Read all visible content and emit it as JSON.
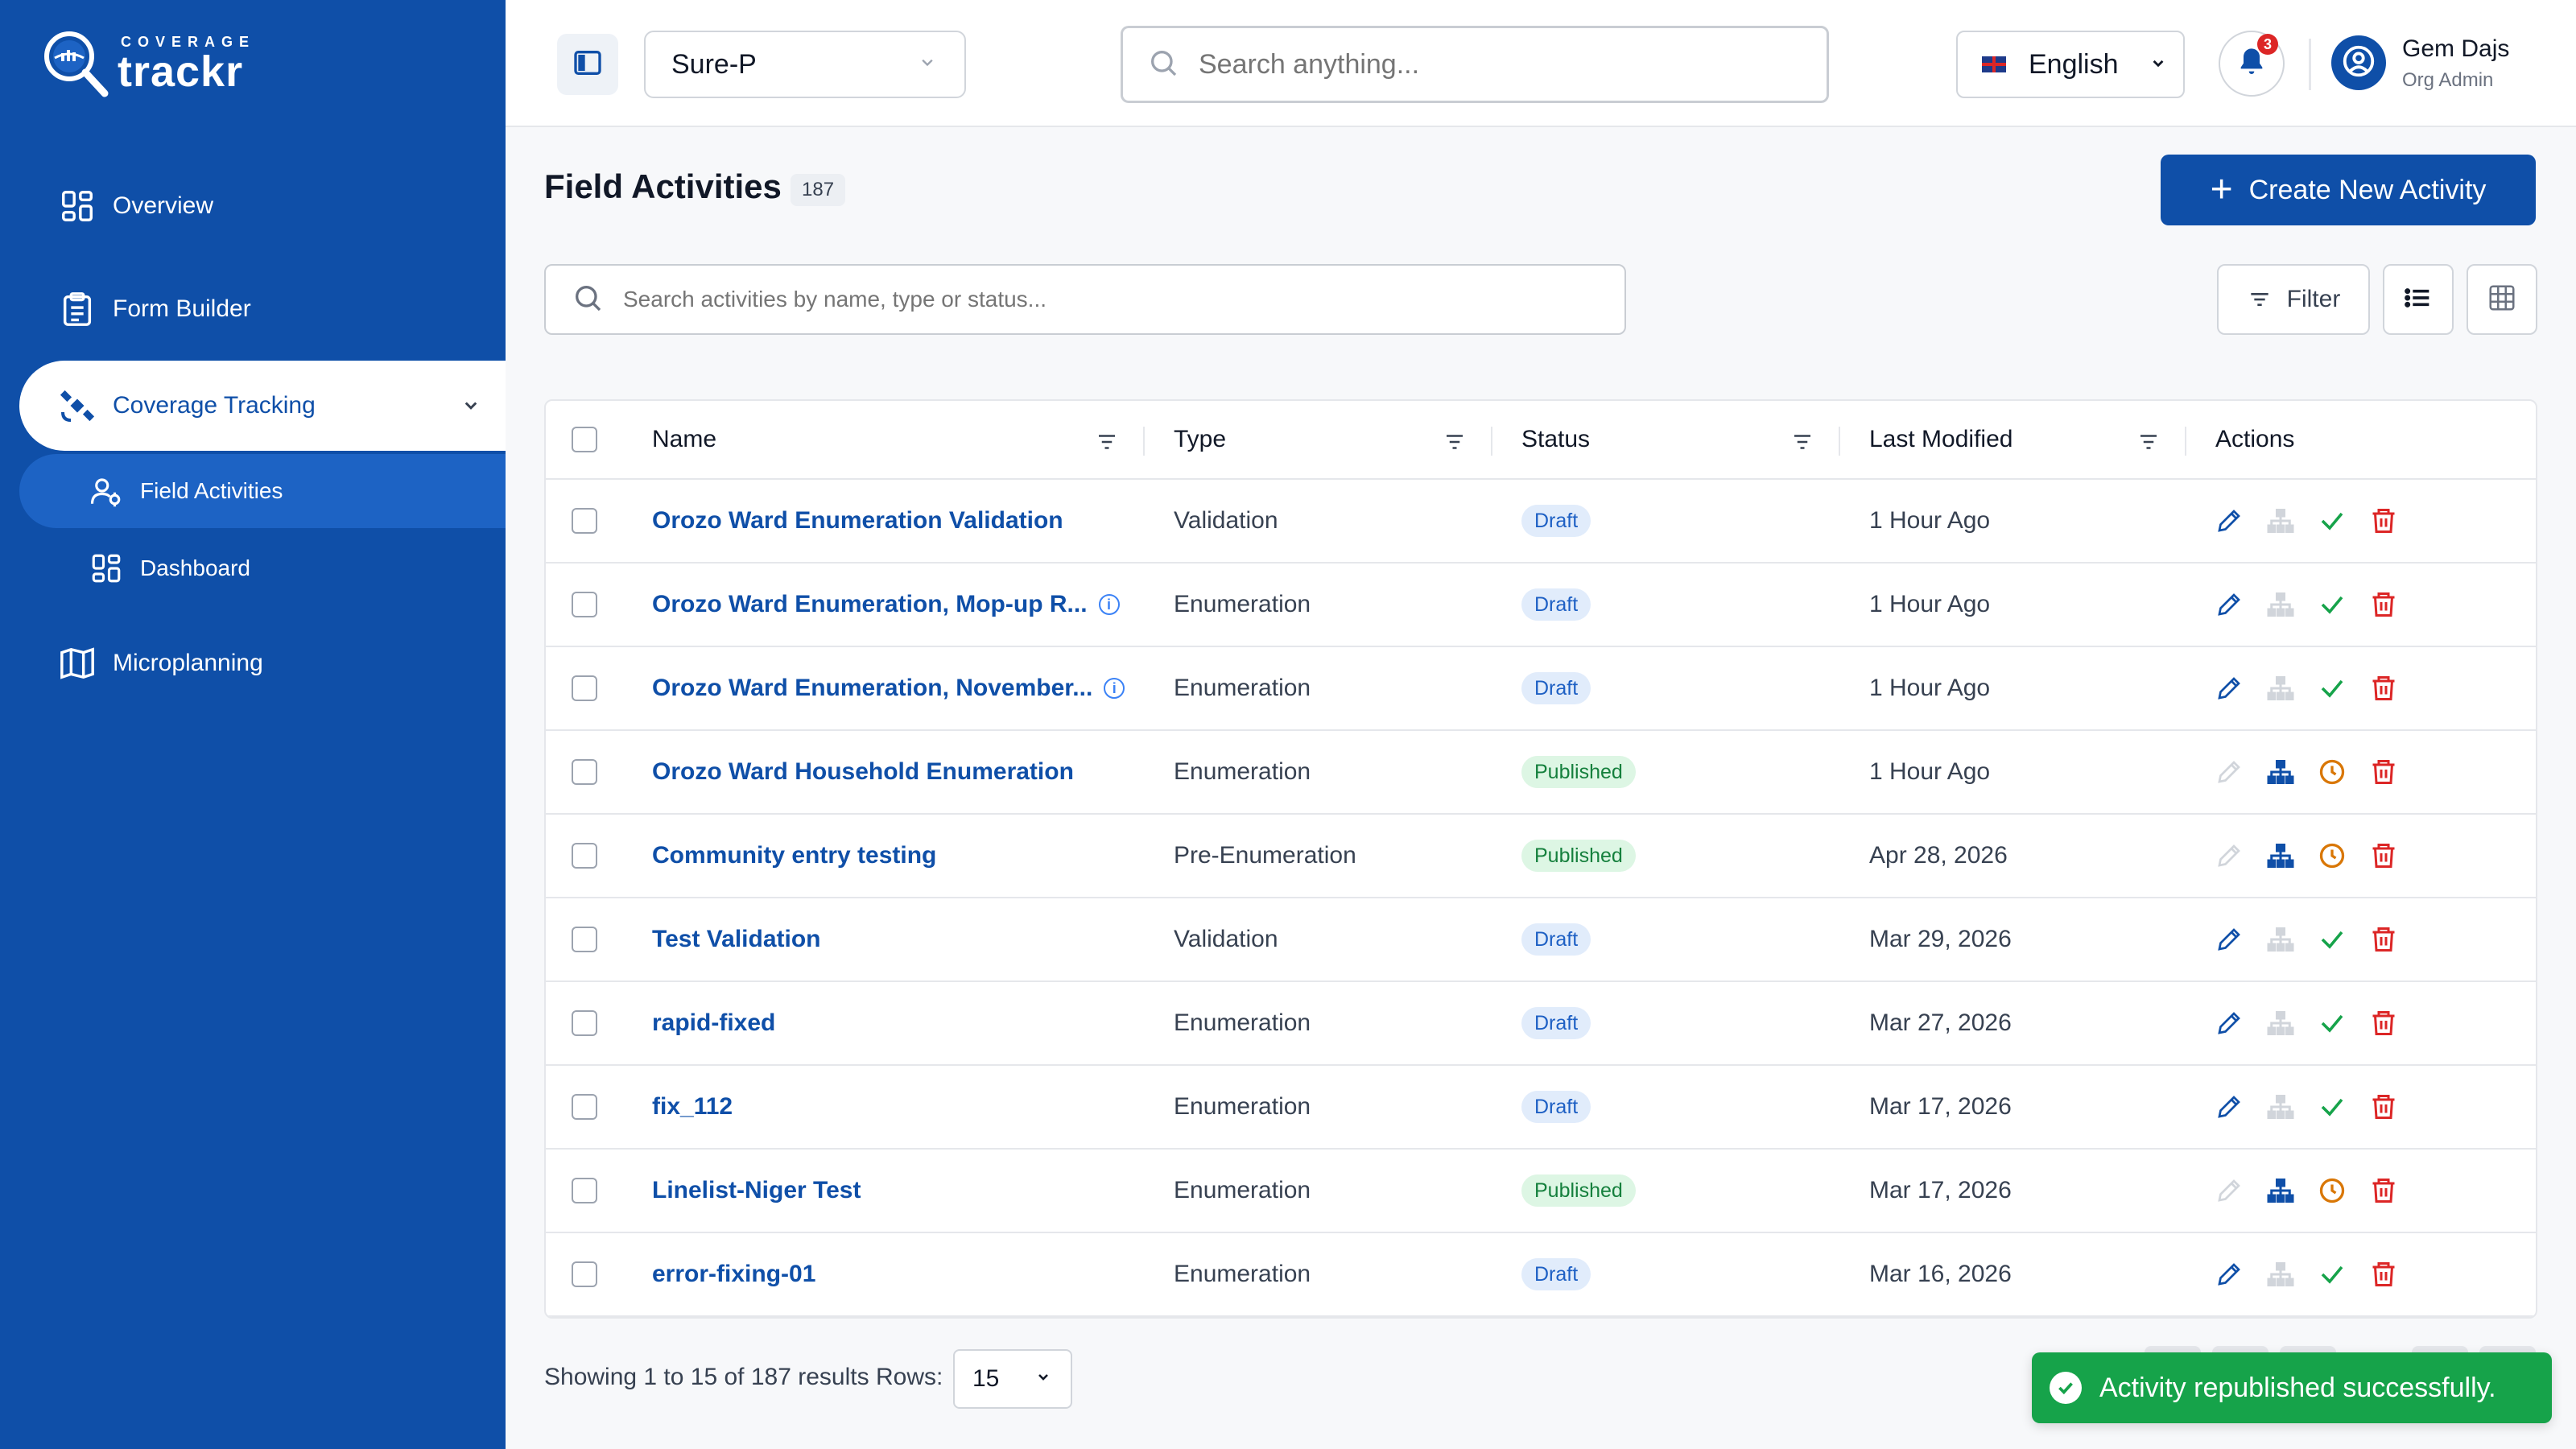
{
  "brand": {
    "top": "COVERAGE",
    "name": "trackr"
  },
  "sidebar": {
    "items": [
      {
        "label": "Overview",
        "icon": "grid-icon"
      },
      {
        "label": "Form Builder",
        "icon": "clipboard-icon"
      },
      {
        "label": "Coverage Tracking",
        "icon": "satellite-icon"
      },
      {
        "label": "Field Activities",
        "icon": "user-group-icon"
      },
      {
        "label": "Dashboard",
        "icon": "grid-icon"
      },
      {
        "label": "Microplanning",
        "icon": "map-icon"
      }
    ]
  },
  "header": {
    "org_select": "Sure-P",
    "search_placeholder": "Search anything...",
    "language": "English",
    "notification_count": "3",
    "user_name": "Gem Dajs",
    "user_role": "Org Admin"
  },
  "page": {
    "title": "Field Activities",
    "count": "187",
    "create_label": "Create New Activity",
    "search_placeholder": "Search activities by name, type or status...",
    "filter_label": "Filter"
  },
  "table": {
    "columns": [
      "Name",
      "Type",
      "Status",
      "Last Modified",
      "Actions"
    ],
    "rows": [
      {
        "name": "Orozo Ward Enumeration Validation",
        "type": "Validation",
        "status": "Draft",
        "modified": "1 Hour Ago",
        "info": false
      },
      {
        "name": "Orozo Ward Enumeration, Mop-up R...",
        "type": "Enumeration",
        "status": "Draft",
        "modified": "1 Hour Ago",
        "info": true
      },
      {
        "name": "Orozo Ward Enumeration, November...",
        "type": "Enumeration",
        "status": "Draft",
        "modified": "1 Hour Ago",
        "info": true
      },
      {
        "name": "Orozo Ward Household Enumeration",
        "type": "Enumeration",
        "status": "Published",
        "modified": "1 Hour Ago",
        "info": false
      },
      {
        "name": "Community entry testing",
        "type": "Pre-Enumeration",
        "status": "Published",
        "modified": "Apr 28, 2026",
        "info": false
      },
      {
        "name": "Test Validation",
        "type": "Validation",
        "status": "Draft",
        "modified": "Mar 29, 2026",
        "info": false
      },
      {
        "name": "rapid-fixed",
        "type": "Enumeration",
        "status": "Draft",
        "modified": "Mar 27, 2026",
        "info": false
      },
      {
        "name": "fix_112",
        "type": "Enumeration",
        "status": "Draft",
        "modified": "Mar 17, 2026",
        "info": false
      },
      {
        "name": "Linelist-Niger Test",
        "type": "Enumeration",
        "status": "Published",
        "modified": "Mar 17, 2026",
        "info": false
      },
      {
        "name": "error-fixing-01",
        "type": "Enumeration",
        "status": "Draft",
        "modified": "Mar 16, 2026",
        "info": false
      }
    ]
  },
  "footer": {
    "showing": "Showing 1 to 15 of 187 results",
    "rows_label": "Rows:",
    "rows_value": "15"
  },
  "toast": {
    "message": "Activity republished successfully."
  },
  "colors": {
    "primary": "#0f4fa8",
    "success": "#16a34a",
    "danger": "#dc2626",
    "warning": "#d97706"
  }
}
